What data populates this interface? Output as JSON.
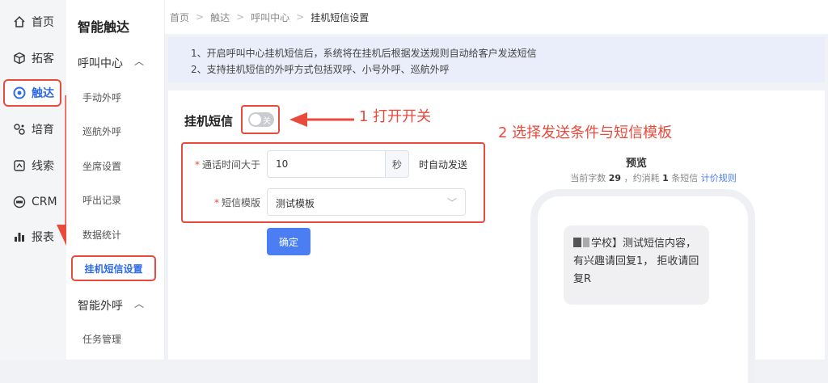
{
  "nav": {
    "items": [
      {
        "label": "首页",
        "icon": "home-icon"
      },
      {
        "label": "拓客",
        "icon": "cube-icon"
      },
      {
        "label": "触达",
        "icon": "target-icon"
      },
      {
        "label": "培育",
        "icon": "nurture-icon"
      },
      {
        "label": "线索",
        "icon": "leads-icon"
      },
      {
        "label": "CRM",
        "icon": "crm-icon"
      },
      {
        "label": "报表",
        "icon": "bar-chart-icon"
      }
    ]
  },
  "sub": {
    "title": "智能触达",
    "group1": "呼叫中心",
    "items": [
      "手动外呼",
      "巡航外呼",
      "坐席设置",
      "呼出记录",
      "数据统计",
      "挂机短信设置"
    ],
    "group2": "智能外呼",
    "group2_items": [
      "任务管理"
    ]
  },
  "breadcrumb": [
    "首页",
    "触达",
    "呼叫中心",
    "挂机短信设置"
  ],
  "notice": [
    "1、开启呼叫中心挂机短信后，系统将在挂机后根据发送规则自动给客户发送短信",
    "2、支持挂机短信的外呼方式包括双呼、小号外呼、巡航外呼"
  ],
  "panel": {
    "title": "挂机短信",
    "switch_label": "关"
  },
  "annotations": {
    "a1": "1 打开开关",
    "a2": "2 选择发送条件与短信模板"
  },
  "form": {
    "call_label": "通话时间大于",
    "call_value": "10",
    "call_unit": "秒",
    "call_after": "时自动发送",
    "tpl_label": "短信模版",
    "tpl_value": "测试模板",
    "submit": "确定"
  },
  "preview": {
    "title": "预览",
    "stat_pre": "当前字数",
    "count": "29",
    "stat_mid": "，约消耗",
    "msgs": "1",
    "stat_post": "条短信",
    "link": "计价规则",
    "sms_head": "学校】测试短信内容，有兴趣请回复1， 拒收请回复R"
  }
}
